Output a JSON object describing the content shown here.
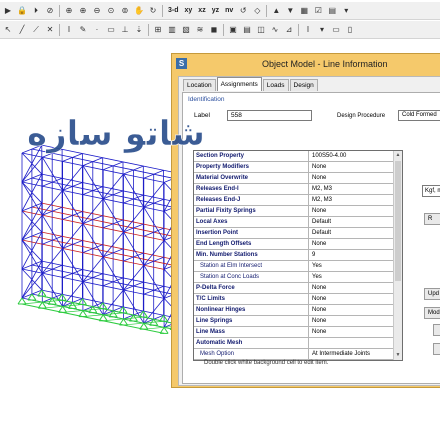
{
  "toolbar_top": {
    "view_buttons": [
      "3-d",
      "xy",
      "xz",
      "yz",
      "nv"
    ]
  },
  "dialog": {
    "title": "Object Model - Line Information",
    "app_icon_letter": "S",
    "tabs": [
      "Location",
      "Assignments",
      "Loads",
      "Design"
    ],
    "active_tab": "Assignments",
    "identification_label": "Identification",
    "label_caption": "Label",
    "label_value": "558",
    "design_procedure_caption": "Design Procedure",
    "design_procedure_value": "Cold Formed",
    "properties": [
      {
        "name": "Section Property",
        "value": "100S50-4.00",
        "sub": false
      },
      {
        "name": "Property Modifiers",
        "value": "None",
        "sub": false
      },
      {
        "name": "Material Overwrite",
        "value": "None",
        "sub": false
      },
      {
        "name": "Releases End-I",
        "value": "M2, M3",
        "sub": false
      },
      {
        "name": "Releases End-J",
        "value": "M2, M3",
        "sub": false
      },
      {
        "name": "Partial Fixity Springs",
        "value": "None",
        "sub": false
      },
      {
        "name": "Local Axes",
        "value": "Default",
        "sub": false
      },
      {
        "name": "Insertion Point",
        "value": "Default",
        "sub": false
      },
      {
        "name": "End Length Offsets",
        "value": "None",
        "sub": false
      },
      {
        "name": "Min. Number Stations",
        "value": "9",
        "sub": false
      },
      {
        "name": "Station at Elm Intersect",
        "value": "Yes",
        "sub": true
      },
      {
        "name": "Station at Conc Loads",
        "value": "Yes",
        "sub": true
      },
      {
        "name": "P-Delta Force",
        "value": "None",
        "sub": false
      },
      {
        "name": "T/C Limits",
        "value": "None",
        "sub": false
      },
      {
        "name": "Nonlinear Hinges",
        "value": "None",
        "sub": false
      },
      {
        "name": "Line Springs",
        "value": "None",
        "sub": false
      },
      {
        "name": "Line Mass",
        "value": "None",
        "sub": false
      },
      {
        "name": "Automatic Mesh",
        "value": "",
        "sub": false
      },
      {
        "name": "Mesh Option",
        "value": "At Intermediate Joints",
        "sub": true
      }
    ],
    "hint": "Double click white background cell to edit item.",
    "side_controls": {
      "units_field": "Kgf, m",
      "button_r": "R",
      "button_update": "Upd",
      "button_modify": "Mod"
    }
  },
  "watermark": {
    "text": "شاتو سازه"
  },
  "colors": {
    "dialog_frame": "#f5c96b",
    "frame_blue": "#1c1cc8",
    "frame_red": "#c81c1c",
    "support_green": "#2ecc40",
    "watermark_blue": "#2a4e8c",
    "label_navy": "#111a6e"
  }
}
